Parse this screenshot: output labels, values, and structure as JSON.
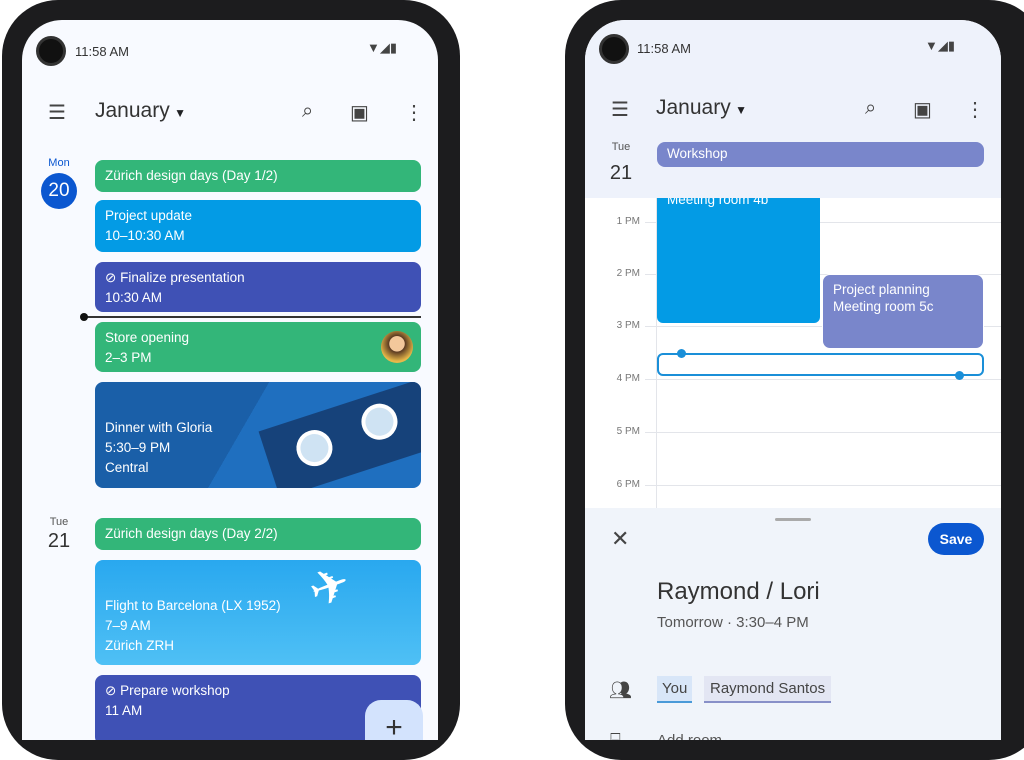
{
  "left": {
    "status_time": "11:58 AM",
    "month": "January",
    "days": [
      {
        "dow": "Mon",
        "date": "20"
      },
      {
        "dow": "Tue",
        "date": "21"
      }
    ],
    "events": [
      {
        "title": "Zürich design days (Day 1/2)"
      },
      {
        "title": "Project update",
        "time": "10–10:30 AM"
      },
      {
        "title": "Finalize presentation",
        "time": "10:30 AM"
      },
      {
        "title": "Store opening",
        "time": "2–3 PM"
      },
      {
        "title": "Dinner with Gloria",
        "time": "5:30–9 PM",
        "location": "Central"
      },
      {
        "title": "Zürich design days (Day 2/2)"
      },
      {
        "title": "Flight to Barcelona (LX 1952)",
        "time": "7–9 AM",
        "location": "Zürich ZRH"
      },
      {
        "title": "Prepare workshop",
        "time": "11 AM"
      }
    ],
    "fab": "+"
  },
  "right": {
    "status_time": "11:58 AM",
    "month": "January",
    "day": {
      "dow": "Tue",
      "date": "21"
    },
    "allday": "Workshop",
    "hours": [
      "1 PM",
      "2 PM",
      "3 PM",
      "4 PM",
      "5 PM",
      "6 PM"
    ],
    "event1": "Meeting room 4b",
    "event2": {
      "title": "Project planning",
      "location": "Meeting room 5c"
    },
    "sheet": {
      "save": "Save",
      "title": "Raymond / Lori",
      "when": "Tomorrow · 3:30–4 PM",
      "guests": [
        "You",
        "Raymond Santos"
      ],
      "add_room": "Add room"
    }
  },
  "colors": {
    "green": "#33b679",
    "blue": "#039be5",
    "indigo": "#3f51b5",
    "lavender": "#7986cb",
    "accent": "#0b57d0"
  }
}
